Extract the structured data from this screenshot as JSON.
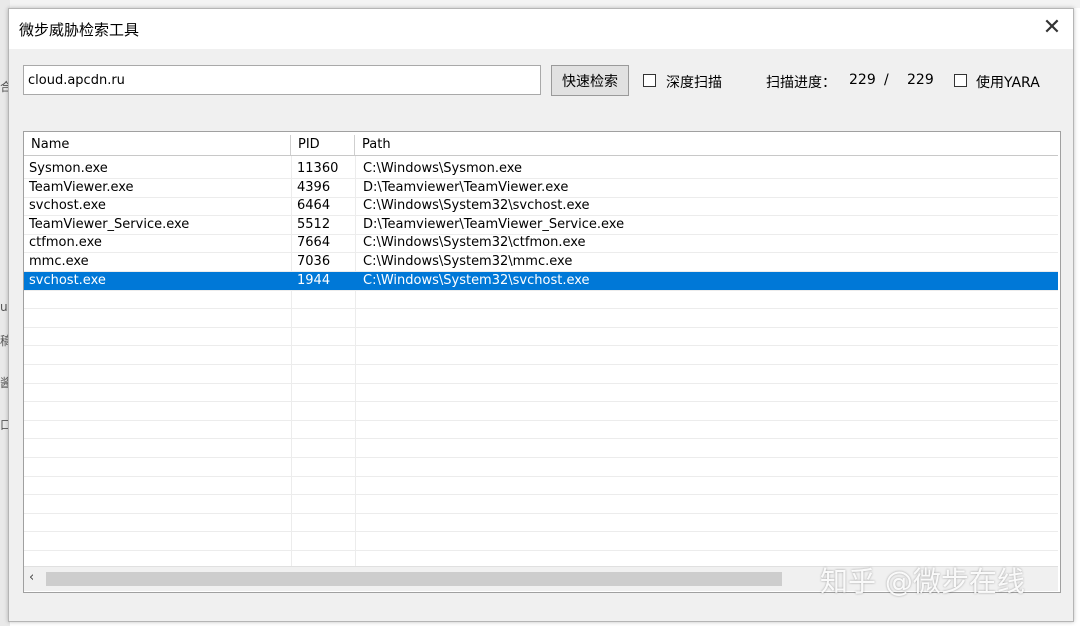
{
  "window": {
    "title": "微步威胁检索工具",
    "close_glyph": "✕"
  },
  "background": {
    "left_chars": [
      "合",
      "u",
      "稿",
      "酱",
      "口"
    ]
  },
  "search": {
    "value": "cloud.apcdn.ru"
  },
  "toolbar": {
    "quick_search_label": "快速检索",
    "deep_scan_label": "深度扫描",
    "progress_label": "扫描进度：",
    "progress_done": "229",
    "progress_sep": "/",
    "progress_total": "229",
    "yara_label": "使用YARA"
  },
  "table": {
    "columns": [
      "Name",
      "PID",
      "Path"
    ],
    "rows": [
      {
        "name": "Sysmon.exe",
        "pid": "11360",
        "path": "C:\\Windows\\Sysmon.exe"
      },
      {
        "name": "TeamViewer.exe",
        "pid": "4396",
        "path": "D:\\Teamviewer\\TeamViewer.exe"
      },
      {
        "name": "svchost.exe",
        "pid": "6464",
        "path": "C:\\Windows\\System32\\svchost.exe"
      },
      {
        "name": "TeamViewer_Service.exe",
        "pid": "5512",
        "path": "D:\\Teamviewer\\TeamViewer_Service.exe"
      },
      {
        "name": "ctfmon.exe",
        "pid": "7664",
        "path": "C:\\Windows\\System32\\ctfmon.exe"
      },
      {
        "name": "mmc.exe",
        "pid": "7036",
        "path": "C:\\Windows\\System32\\mmc.exe"
      },
      {
        "name": "svchost.exe",
        "pid": "1944",
        "path": "C:\\Windows\\System32\\svchost.exe"
      }
    ],
    "selected_index": 6
  },
  "scrollbar": {
    "left_arrow": "‹"
  },
  "watermark": "知乎 @微步在线",
  "colors": {
    "selection": "#0078d7"
  }
}
